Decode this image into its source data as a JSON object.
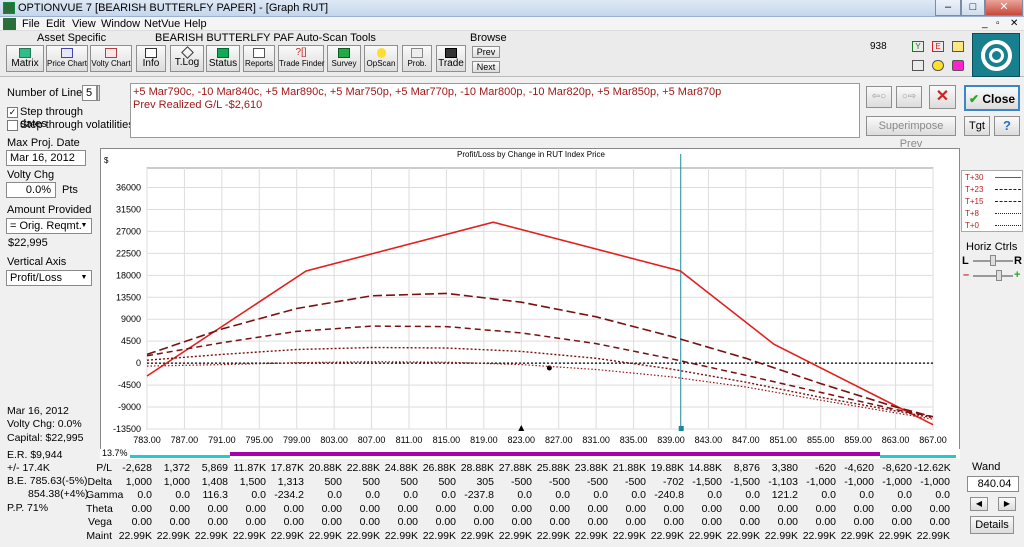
{
  "window": {
    "title": "OPTIONVUE 7  [BEARISH BUTTERLFY PAPER] - [Graph RUT]"
  },
  "menu": [
    "File",
    "Edit",
    "View",
    "Window",
    "NetVue",
    "Help"
  ],
  "toolbar": {
    "group_asset": "Asset Specific",
    "group_title": "BEARISH BUTTERLFY PAF",
    "group_autoscan": "Auto-Scan Tools",
    "group_browse": "Browse",
    "buttons": [
      "Matrix",
      "Price Chart",
      "Volty Chart",
      "Info",
      "T.Log",
      "Status",
      "Reports",
      "Trade Finder",
      "Survey",
      "OpScan",
      "Prob.",
      "Trade"
    ],
    "prev": "Prev",
    "next": "Next",
    "counter": "938"
  },
  "left": {
    "number_of_lines_label": "Number of Lines",
    "number_of_lines_value": "5",
    "step_dates_label": "Step through dates",
    "step_dates_checked": true,
    "step_vol_label": "Step through volatilities",
    "step_vol_checked": false,
    "max_proj_label": "Max Proj. Date",
    "max_proj_value": "Mar 16, 2012",
    "volty_chg_label": "Volty Chg",
    "volty_chg_value": "0.0%",
    "volty_unit": "Pts",
    "amount_label": "Amount Provided",
    "amount_option": "= Orig. Reqmt.",
    "amount_value": "$22,995",
    "vaxis_label": "Vertical Axis",
    "vaxis_option": "Profit/Loss"
  },
  "description": {
    "line1": "+5 Mar790c, -10 Mar840c, +5 Mar890c, +5 Mar750p, +5 Mar770p, -10 Mar800p, -10 Mar820p, +5 Mar850p, +5 Mar870p",
    "line2": "Prev Realized G/L -$2,610"
  },
  "right": {
    "close_label": "Close",
    "superimpose_label": "Superimpose Prev",
    "tgt_label": "Tgt",
    "help_label": "?",
    "horiz_ctrls": "Horiz Ctrls",
    "l_label": "L",
    "r_label": "R",
    "wand_label": "Wand",
    "wand_value": "840.04",
    "details_label": "Details"
  },
  "bottom_left": {
    "date": "Mar 16, 2012",
    "volty": "Volty Chg:  0.0%",
    "capital": "Capital:  $22,995",
    "er": "E.R. $9,944",
    "er_pm": "+/-   17.4K",
    "be1": "B.E. 785.63(-5%)",
    "be2": "854.38(+4%)",
    "pp": "P.P.  71%",
    "pct": "13.7%"
  },
  "table": {
    "rows": [
      {
        "label": "P/L",
        "values": [
          "-2,628",
          "1,372",
          "5,869",
          "11.87K",
          "17.87K",
          "20.88K",
          "22.88K",
          "24.88K",
          "26.88K",
          "28.88K",
          "27.88K",
          "25.88K",
          "23.88K",
          "21.88K",
          "19.88K",
          "14.88K",
          "8,876",
          "3,380",
          "-620",
          "-4,620",
          "-8,620",
          "-12.62K"
        ]
      },
      {
        "label": "Delta",
        "values": [
          "1,000",
          "1,000",
          "1,408",
          "1,500",
          "1,313",
          "500",
          "500",
          "500",
          "500",
          "305",
          "-500",
          "-500",
          "-500",
          "-500",
          "-702",
          "-1,500",
          "-1,500",
          "-1,103",
          "-1,000",
          "-1,000",
          "-1,000",
          "-1,000"
        ]
      },
      {
        "label": "Gamma",
        "values": [
          "0.0",
          "0.0",
          "116.3",
          "0.0",
          "-234.2",
          "0.0",
          "0.0",
          "0.0",
          "0.0",
          "-237.8",
          "0.0",
          "0.0",
          "0.0",
          "0.0",
          "-240.8",
          "0.0",
          "0.0",
          "121.2",
          "0.0",
          "0.0",
          "0.0",
          "0.0"
        ]
      },
      {
        "label": "Theta",
        "values": [
          "0.00",
          "0.00",
          "0.00",
          "0.00",
          "0.00",
          "0.00",
          "0.00",
          "0.00",
          "0.00",
          "0.00",
          "0.00",
          "0.00",
          "0.00",
          "0.00",
          "0.00",
          "0.00",
          "0.00",
          "0.00",
          "0.00",
          "0.00",
          "0.00",
          "0.00"
        ]
      },
      {
        "label": "Vega",
        "values": [
          "0.00",
          "0.00",
          "0.00",
          "0.00",
          "0.00",
          "0.00",
          "0.00",
          "0.00",
          "0.00",
          "0.00",
          "0.00",
          "0.00",
          "0.00",
          "0.00",
          "0.00",
          "0.00",
          "0.00",
          "0.00",
          "0.00",
          "0.00",
          "0.00",
          "0.00"
        ]
      },
      {
        "label": "Maint",
        "values": [
          "22.99K",
          "22.99K",
          "22.99K",
          "22.99K",
          "22.99K",
          "22.99K",
          "22.99K",
          "22.99K",
          "22.99K",
          "22.99K",
          "22.99K",
          "22.99K",
          "22.99K",
          "22.99K",
          "22.99K",
          "22.99K",
          "22.99K",
          "22.99K",
          "22.99K",
          "22.99K",
          "22.99K",
          "22.99K"
        ]
      }
    ]
  },
  "chart_data": {
    "type": "line",
    "title": "Profit/Loss by Change in RUT Index Price",
    "ylabel": "$",
    "xlim": [
      783,
      867
    ],
    "ylim": [
      -13500,
      40000
    ],
    "xticks": [
      783,
      787,
      791,
      795,
      799,
      803,
      807,
      811,
      815,
      819,
      823,
      827,
      831,
      835,
      839,
      843,
      847,
      851,
      855,
      859,
      863,
      867
    ],
    "xtick_labels": [
      "783.00",
      "787.00",
      "791.00",
      "795.00",
      "799.00",
      "803.00",
      "807.00",
      "811.00",
      "815.00",
      "819.00",
      "823.00",
      "827.00",
      "831.00",
      "835.00",
      "839.00",
      "843.00",
      "847.00",
      "851.00",
      "855.00",
      "859.00",
      "863.00",
      "867.00"
    ],
    "yticks": [
      -13500,
      -9000,
      -4500,
      0,
      4500,
      9000,
      13500,
      18000,
      22500,
      27000,
      31500,
      36000
    ],
    "ytick_labels": [
      "-13500",
      "-9000",
      "-4500",
      "0",
      "4500",
      "9000",
      "13500",
      "18000",
      "22500",
      "27000",
      "31500",
      "36000"
    ],
    "wand_x": 840.04,
    "marker_x": 823,
    "series": [
      {
        "name": "T+30",
        "style": "solid",
        "x": [
          783,
          800,
          820,
          840,
          850,
          867
        ],
        "y": [
          -2628,
          18880,
          28880,
          18880,
          3880,
          -12620
        ]
      },
      {
        "name": "T+23",
        "style": "longdash",
        "x": [
          783,
          791,
          799,
          807,
          815,
          823,
          831,
          839,
          847,
          855,
          863,
          867
        ],
        "y": [
          1800,
          7000,
          11200,
          13800,
          14300,
          12500,
          9500,
          5500,
          1000,
          -4200,
          -9000,
          -11000
        ]
      },
      {
        "name": "T+15",
        "style": "dash",
        "x": [
          783,
          791,
          799,
          807,
          815,
          823,
          831,
          839,
          847,
          855,
          863,
          867
        ],
        "y": [
          1500,
          4200,
          6500,
          7600,
          7500,
          6200,
          4000,
          900,
          -2500,
          -6000,
          -9500,
          -11000
        ]
      },
      {
        "name": "T+8",
        "style": "dot",
        "x": [
          783,
          791,
          799,
          807,
          815,
          823,
          831,
          839,
          847,
          855,
          863,
          867
        ],
        "y": [
          600,
          1800,
          2800,
          3200,
          3100,
          2400,
          1000,
          -1200,
          -3900,
          -7000,
          -9800,
          -11200
        ]
      },
      {
        "name": "T+0",
        "style": "finedot",
        "x": [
          783,
          791,
          799,
          807,
          815,
          823,
          831,
          839,
          847,
          855,
          863,
          867
        ],
        "y": [
          -600,
          -300,
          100,
          300,
          200,
          -300,
          -1300,
          -2800,
          -4900,
          -7600,
          -10200,
          -11500
        ]
      }
    ],
    "zero_line": true,
    "legend": [
      "T+30",
      "T+23",
      "T+15",
      "T+8",
      "T+0"
    ],
    "legend_position": "right"
  }
}
